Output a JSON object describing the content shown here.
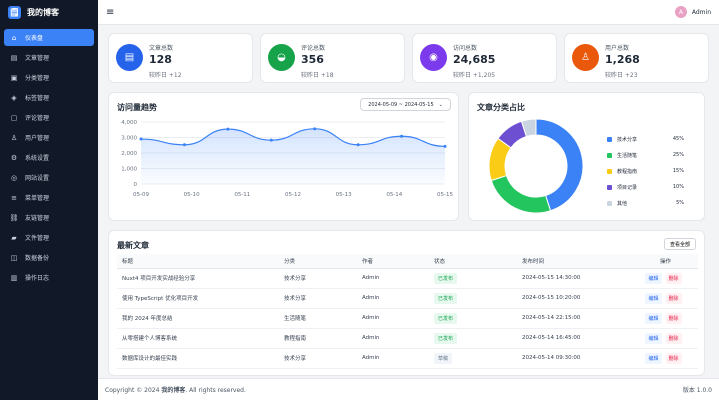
{
  "app": {
    "logo_icon": "🗒",
    "title": "我的博客"
  },
  "sidebar": {
    "items": [
      {
        "icon": "⌂",
        "label": "仪表盘",
        "active": true
      },
      {
        "icon": "▤",
        "label": "文章管理"
      },
      {
        "icon": "▣",
        "label": "分类管理"
      },
      {
        "icon": "◈",
        "label": "标签管理"
      },
      {
        "icon": "▢",
        "label": "评论管理"
      },
      {
        "icon": "♙",
        "label": "用户管理"
      },
      {
        "icon": "⚙",
        "label": "系统设置"
      },
      {
        "icon": "◎",
        "label": "网站设置"
      },
      {
        "icon": "≡",
        "label": "菜单管理"
      },
      {
        "icon": "⛓",
        "label": "友链管理"
      },
      {
        "icon": "▰",
        "label": "文件管理"
      },
      {
        "icon": "◫",
        "label": "数据备份"
      },
      {
        "icon": "▥",
        "label": "操作日志"
      }
    ]
  },
  "topbar": {
    "menu_icon": "≡",
    "user_initial": "A",
    "user_name": "Admin"
  },
  "stats": [
    {
      "icon": "▤",
      "title": "文章总数",
      "value": "128",
      "delta": "较昨日 +12",
      "color": "#2563eb"
    },
    {
      "icon": "◒",
      "title": "评论总数",
      "value": "356",
      "delta": "较昨日 +18",
      "color": "#16a34a"
    },
    {
      "icon": "◉",
      "title": "访问总数",
      "value": "24,685",
      "delta": "较昨日 +1,205",
      "color": "#7c3aed"
    },
    {
      "icon": "♙",
      "title": "用户总数",
      "value": "1,268",
      "delta": "较昨日 +23",
      "color": "#ea580c"
    }
  ],
  "visits": {
    "title": "访问量趋势",
    "date_range": "2024-05-09 ~ 2024-05-15",
    "range_arrow": "⌄"
  },
  "chart_data": [
    {
      "type": "area",
      "title": "访问量趋势",
      "x": [
        "05-09",
        "05-10",
        "05-11",
        "05-12",
        "05-13",
        "05-14",
        "05-15"
      ],
      "series": [
        {
          "values": [
            2900,
            2530,
            3540,
            2830,
            3560,
            2530,
            3080,
            2430
          ]
        }
      ],
      "y_ticks": [
        "4,000",
        "3,000",
        "2,000",
        "1,000",
        "0"
      ],
      "ylim": [
        0,
        4000
      ],
      "grid": true,
      "color": "#3b82f6"
    },
    {
      "type": "pie",
      "title": "文章分类占比",
      "labels": [
        "技术分享",
        "生活随笔",
        "教程指南",
        "项目记录",
        "其他"
      ],
      "values": [
        45,
        25,
        15,
        10,
        5
      ],
      "colors": [
        "#3b82f6",
        "#22c55e",
        "#facc15",
        "#6d4fd1",
        "#cbd5e1"
      ],
      "donut": true
    }
  ],
  "category": {
    "title": "文章分类占比",
    "legend": [
      {
        "name": "技术分享",
        "percent": "45%"
      },
      {
        "name": "生活随笔",
        "percent": "25%"
      },
      {
        "name": "教程指南",
        "percent": "15%"
      },
      {
        "name": "项目记录",
        "percent": "10%"
      },
      {
        "name": "其他",
        "percent": "5%"
      }
    ]
  },
  "recent": {
    "title": "最新文章",
    "view_all": "查看全部",
    "columns": [
      "标题",
      "分类",
      "作者",
      "状态",
      "发布时间",
      "操作"
    ],
    "rows": [
      {
        "title": "Nuxt4 项目开发实战经验分享",
        "category": "技术分享",
        "author": "Admin",
        "status": "已发布",
        "status_type": "published",
        "time": "2024-05-15 14:30:00",
        "edit": "编辑",
        "delete": "删除"
      },
      {
        "title": "使用 TypeScript 优化项目开发",
        "category": "技术分享",
        "author": "Admin",
        "status": "已发布",
        "status_type": "published",
        "time": "2024-05-15 10:20:00",
        "edit": "编辑",
        "delete": "删除"
      },
      {
        "title": "我的 2024 年度总结",
        "category": "生活随笔",
        "author": "Admin",
        "status": "已发布",
        "status_type": "published",
        "time": "2024-05-14 22:15:00",
        "edit": "编辑",
        "delete": "删除"
      },
      {
        "title": "从零搭建个人博客系统",
        "category": "教程指南",
        "author": "Admin",
        "status": "已发布",
        "status_type": "published",
        "time": "2024-05-14 16:45:00",
        "edit": "编辑",
        "delete": "删除"
      },
      {
        "title": "数据库设计的最佳实践",
        "category": "技术分享",
        "author": "Admin",
        "status": "草稿",
        "status_type": "draft",
        "time": "2024-05-14 09:30:00",
        "edit": "编辑",
        "delete": "删除"
      }
    ]
  },
  "footer": {
    "copyright_prefix": "Copyright © 2024 ",
    "copyright_name": "我的博客",
    "copyright_suffix": ". All rights reserved.",
    "version": "版本 1.0.0"
  }
}
